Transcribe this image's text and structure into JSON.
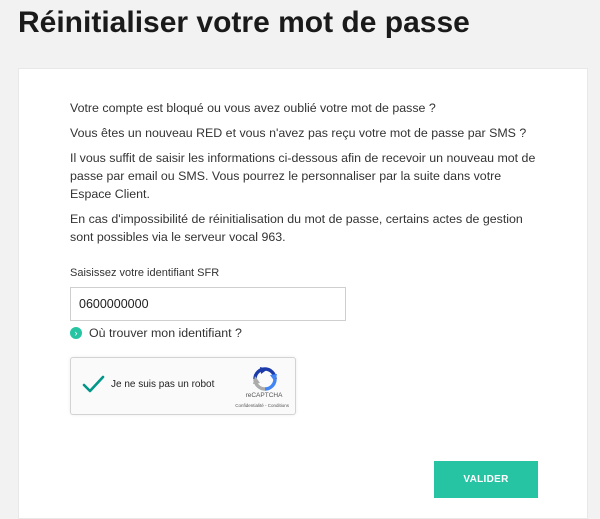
{
  "page": {
    "title": "Réinitialiser votre mot de passe"
  },
  "intro": {
    "line1": "Votre compte est bloqué ou vous avez oublié votre mot de passe ?",
    "line2": "Vous êtes un nouveau RED et vous n'avez pas reçu votre mot de passe par SMS ?",
    "line3": "Il vous suffit de saisir les informations ci-dessous afin de recevoir un nouveau mot de passe par email ou SMS. Vous pourrez le personnaliser par la suite dans votre Espace Client.",
    "line4": "En cas d'impossibilité de réinitialisation du mot de passe, certains actes de gestion sont possibles via le serveur vocal 963."
  },
  "form": {
    "identifier_label": "Saisissez votre identifiant SFR",
    "identifier_value": "0600000000",
    "help_link": "Où trouver mon identifiant ?",
    "help_icon": "chevron-right-icon",
    "submit_label": "VALIDER"
  },
  "captcha": {
    "label": "Je ne suis pas un robot",
    "checked": true,
    "brand": "reCAPTCHA",
    "links": "Confidentialité - Conditions"
  },
  "colors": {
    "accent": "#26c4a3",
    "background": "#f2f2f2",
    "card": "#ffffff",
    "check": "#009688"
  }
}
